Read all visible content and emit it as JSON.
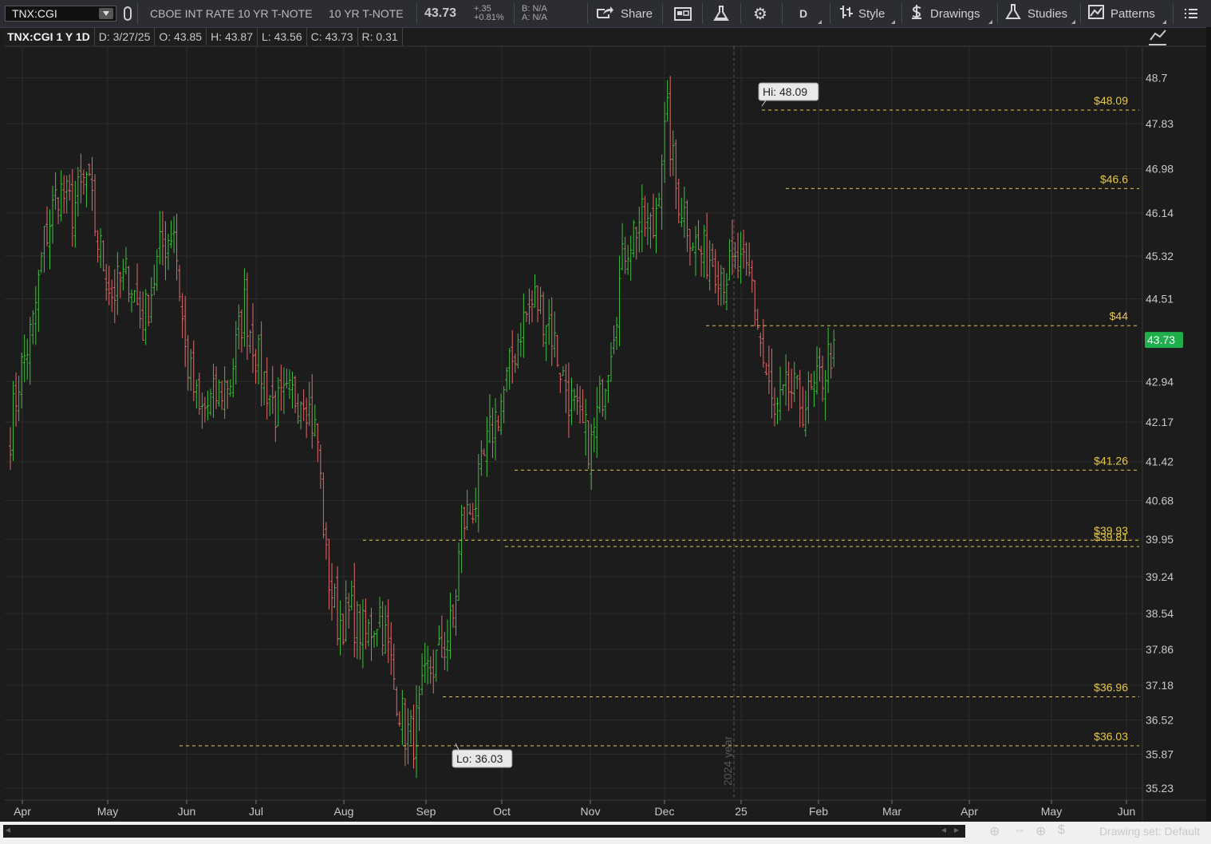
{
  "toolbar": {
    "symbol": "TNX:CGI",
    "description": "CBOE INT RATE 10 YR T-NOTE",
    "short_name": "10 YR T-NOTE",
    "last_price": "43.73",
    "change": "+.35",
    "change_pct": "+0.81%",
    "bid": "B: N/A",
    "ask": "A: N/A",
    "share_label": "Share",
    "period_label": "D",
    "style_label": "Style",
    "drawings_label": "Drawings",
    "studies_label": "Studies",
    "patterns_label": "Patterns",
    "icons": [
      "link-icon",
      "share-icon",
      "calendar-icon",
      "flask-icon",
      "gear-icon",
      "style-icon",
      "drawings-icon",
      "studies-icon",
      "patterns-icon",
      "menu-icon"
    ]
  },
  "info": {
    "title": "TNX:CGI 1 Y 1D",
    "date": "D: 3/27/25",
    "open": "O: 43.85",
    "high": "H: 43.87",
    "low": "L: 43.56",
    "close": "C: 43.73",
    "range": "R: 0.31"
  },
  "chart_data": {
    "type": "ohlc",
    "symbol": "TNX:CGI",
    "y_ticks": [
      48.7,
      47.83,
      46.98,
      46.14,
      45.32,
      44.51,
      42.94,
      42.17,
      41.42,
      40.68,
      39.95,
      39.24,
      38.54,
      37.86,
      37.18,
      36.52,
      35.87,
      35.23
    ],
    "x_ticks": [
      "Apr",
      "May",
      "Jun",
      "Jul",
      "Aug",
      "Sep",
      "Oct",
      "Nov",
      "Dec",
      "25",
      "Feb",
      "Mar",
      "Apr",
      "May",
      "Jun"
    ],
    "last_price_label": "43.73",
    "year_marker": "2024 year",
    "hi_label": "Hi: 48.09",
    "lo_label": "Lo: 36.03",
    "levels": [
      {
        "value": 48.09,
        "label": "$48.09"
      },
      {
        "value": 46.6,
        "label": "$46.6"
      },
      {
        "value": 44.0,
        "label": "$44"
      },
      {
        "value": 41.26,
        "label": "$41.26"
      },
      {
        "value": 39.93,
        "label": "$39.93"
      },
      {
        "value": 39.81,
        "label": "$39.81"
      },
      {
        "value": 36.96,
        "label": "$36.96"
      },
      {
        "value": 36.03,
        "label": "$36.03"
      }
    ],
    "anchors": [
      [
        0,
        42.0
      ],
      [
        3,
        43.0
      ],
      [
        8,
        44.0
      ],
      [
        12,
        45.6
      ],
      [
        17,
        46.6
      ],
      [
        22,
        46.2
      ],
      [
        27,
        46.8
      ],
      [
        31,
        45.6
      ],
      [
        36,
        44.6
      ],
      [
        42,
        45.0
      ],
      [
        47,
        44.0
      ],
      [
        53,
        45.4
      ],
      [
        58,
        45.9
      ],
      [
        62,
        43.5
      ],
      [
        67,
        42.3
      ],
      [
        72,
        42.6
      ],
      [
        78,
        43.0
      ],
      [
        83,
        44.4
      ],
      [
        88,
        43.3
      ],
      [
        94,
        42.4
      ],
      [
        99,
        42.6
      ],
      [
        104,
        42.8
      ],
      [
        109,
        41.8
      ],
      [
        112,
        39.5
      ],
      [
        116,
        38.4
      ],
      [
        121,
        38.5
      ],
      [
        126,
        38.1
      ],
      [
        131,
        38.6
      ],
      [
        136,
        37.3
      ],
      [
        140,
        36.3
      ],
      [
        143,
        36.2
      ],
      [
        148,
        37.4
      ],
      [
        153,
        37.8
      ],
      [
        157,
        38.4
      ],
      [
        160,
        40.2
      ],
      [
        165,
        40.7
      ],
      [
        170,
        41.9
      ],
      [
        176,
        42.9
      ],
      [
        181,
        44.0
      ],
      [
        186,
        44.5
      ],
      [
        191,
        44.1
      ],
      [
        196,
        43.0
      ],
      [
        201,
        42.2
      ],
      [
        206,
        41.7
      ],
      [
        211,
        43.1
      ],
      [
        214,
        44.1
      ],
      [
        218,
        45.5
      ],
      [
        223,
        46.0
      ],
      [
        228,
        45.8
      ],
      [
        231,
        47.3
      ],
      [
        233,
        47.9
      ],
      [
        236,
        46.6
      ],
      [
        240,
        46.0
      ],
      [
        244,
        45.4
      ],
      [
        249,
        45.3
      ],
      [
        253,
        45.0
      ],
      [
        258,
        45.1
      ],
      [
        263,
        44.8
      ],
      [
        267,
        43.3
      ],
      [
        271,
        42.2
      ],
      [
        276,
        42.8
      ],
      [
        281,
        42.5
      ],
      [
        285,
        42.7
      ],
      [
        289,
        43.2
      ],
      [
        292,
        43.73
      ]
    ],
    "x_range": [
      0,
      400
    ],
    "y_range": [
      35.0,
      49.3
    ]
  },
  "footer": {
    "drawing_set": "Drawing set: Default",
    "icons": [
      "zoom-icon",
      "pan-icon",
      "crosshair-icon",
      "price-icon"
    ]
  },
  "colors": {
    "up": "#3fbf3f",
    "down": "#e06a6a",
    "level_line": "#e5c84a",
    "price_tag": "#1fae4c",
    "grid": "#2c2c2c"
  }
}
